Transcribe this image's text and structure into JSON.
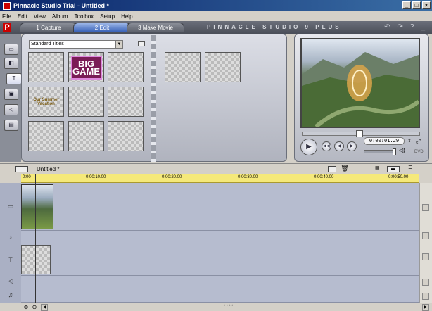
{
  "window": {
    "title": "Pinnacle Studio Trial - Untitled *"
  },
  "menu": [
    "File",
    "Edit",
    "View",
    "Album",
    "Toolbox",
    "Setup",
    "Help"
  ],
  "tabs": [
    {
      "label": "1 Capture"
    },
    {
      "label": "2 Edit"
    },
    {
      "label": "3 Make Movie"
    }
  ],
  "brand": "PINNACLE STUDIO 9 PLUS",
  "album": {
    "selected": "Standard Titles",
    "thumbs": [
      {
        "text": ""
      },
      {
        "text": "BIG GAME"
      },
      {
        "text": ""
      },
      {
        "text": "Our Summer Vacation"
      },
      {
        "text": ""
      },
      {
        "text": ""
      },
      {
        "text": ""
      },
      {
        "text": ""
      },
      {
        "text": ""
      }
    ]
  },
  "preview": {
    "timecode": "0:00:01.29"
  },
  "timeline": {
    "project_name": "Untitled *",
    "ticks": [
      "0:00",
      "0:00:10.00",
      "0:00:20.00",
      "0:00:30.00",
      "0:00:40.00",
      "0:00:50.00"
    ]
  }
}
